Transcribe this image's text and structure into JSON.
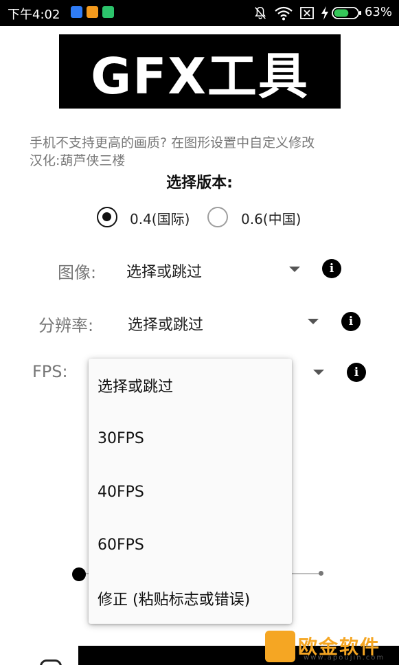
{
  "status_bar": {
    "time": "下午4:02",
    "battery_percent": "63%",
    "battery_level": 0.63,
    "accent": "#35c759"
  },
  "banner": {
    "title": "GFX工具"
  },
  "hint": {
    "line1": "手机不支持更高的画质? 在图形设置中自定义修改",
    "line2": "汉化:葫芦侠三楼"
  },
  "version": {
    "title": "选择版本:",
    "options": [
      {
        "label": "0.4(国际)",
        "checked": true
      },
      {
        "label": "0.6(中国)",
        "checked": false
      }
    ]
  },
  "rows": {
    "graphics": {
      "label": "图像:",
      "value": "选择或跳过"
    },
    "resolution": {
      "label": "分辨率:",
      "value": "选择或跳过"
    },
    "fps": {
      "label": "FPS:"
    }
  },
  "fps_menu": {
    "items": [
      "选择或跳过",
      "30FPS",
      "40FPS",
      "60FPS",
      "修正 (粘贴标志或错误)"
    ]
  },
  "watermark": {
    "name": "欧金软件园",
    "url": "www.apoujin.com"
  },
  "colors": {
    "banner_bg": "#000000",
    "hint_text": "#777777",
    "menu_bg": "#fafafa",
    "watermark": "#f5a623"
  }
}
